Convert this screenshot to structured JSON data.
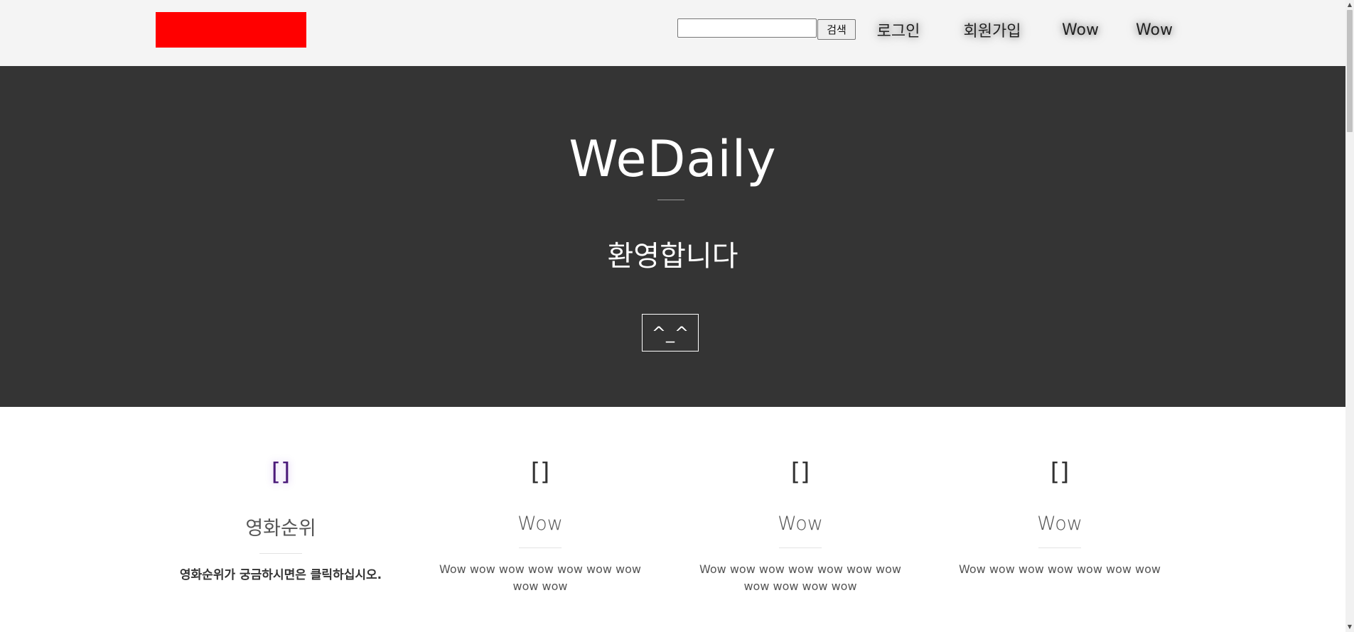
{
  "header": {
    "search": {
      "value": "",
      "placeholder": ""
    },
    "search_button": "검색",
    "nav": [
      "로그인",
      "회원가입",
      "Wow",
      "Wow"
    ]
  },
  "hero": {
    "title": "WeDaily",
    "subtitle": "환영합니다",
    "button": "^_^"
  },
  "features": [
    {
      "icon": "[]",
      "title": "영화순위",
      "text": "영화순위가 궁금하시면은 클릭하십시오."
    },
    {
      "icon": "[]",
      "title": "Wow",
      "text": "Wow wow wow wow wow wow wow wow wow"
    },
    {
      "icon": "[]",
      "title": "Wow",
      "text": "Wow wow wow wow wow wow wow wow wow wow wow"
    },
    {
      "icon": "[]",
      "title": "Wow",
      "text": "Wow wow wow wow wow wow wow"
    }
  ],
  "colors": {
    "logo": "#ff0000",
    "header_bg": "#f4f4f4",
    "hero_bg": "#343434",
    "highlight_icon": "#4b1b7a"
  },
  "icons": {
    "scroll_up": "scroll-up-arrow-icon",
    "scroll_down": "scroll-down-arrow-icon"
  }
}
